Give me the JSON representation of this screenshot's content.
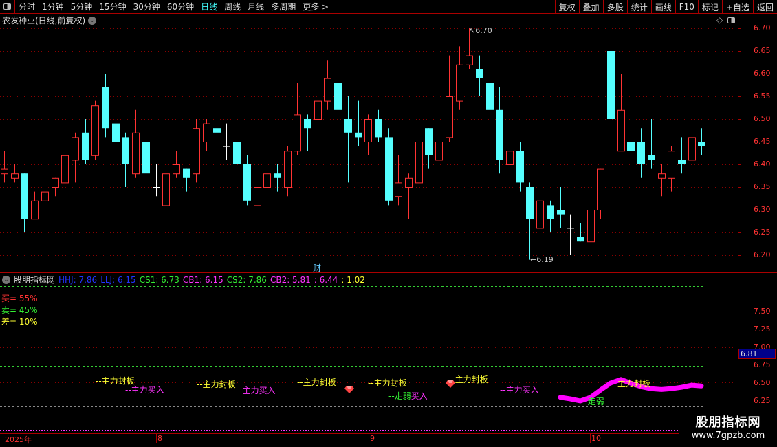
{
  "toolbar": {
    "periods": [
      "分时",
      "1分钟",
      "5分钟",
      "15分钟",
      "30分钟",
      "60分钟",
      "日线",
      "周线",
      "月线",
      "多周期",
      "更多 >"
    ],
    "active_period": "日线",
    "buttons": [
      "复权",
      "叠加",
      "多股",
      "统计",
      "画线",
      "F10",
      "标记",
      "+自选",
      "返回"
    ]
  },
  "title": "农发种业(日线,前复权)",
  "main_axis": [
    "6.70",
    "6.65",
    "6.60",
    "6.55",
    "6.50",
    "6.45",
    "6.40",
    "6.35",
    "6.30",
    "6.25",
    "6.20"
  ],
  "max_label": "6.70",
  "min_label": "6.19",
  "event_marker": "财",
  "indicator": {
    "name": "股朋指标网",
    "values": [
      {
        "label": "HHJ: 7.86",
        "color": "#2233ff"
      },
      {
        "label": "LLJ: 6.15",
        "color": "#2233ff"
      },
      {
        "label": "CS1: 6.73",
        "color": "#33ee33"
      },
      {
        "label": "CB1: 6.15",
        "color": "#ff33ff"
      },
      {
        "label": "CS2: 7.86",
        "color": "#33ee33"
      },
      {
        "label": "CB2: 5.81",
        "color": "#ff33ff"
      },
      {
        "label": ": 6.44",
        "color": "#ff33ff"
      },
      {
        "label": ": 1.02",
        "color": "#ffff33"
      }
    ],
    "buy": "买= 55%",
    "sell": "卖= 45%",
    "diff": "差= 10%",
    "axis": [
      "7.50",
      "7.25",
      "7.00",
      "6.75",
      "6.50",
      "6.25"
    ],
    "current": "6.81",
    "annotations": {
      "seal": "--主力封板",
      "buy": "--主力买入",
      "weak_buy_a": "--走弱",
      "weak_buy_b": "买入",
      "weak": "--走弱",
      "seal_plain": "主力封板"
    },
    "pink_line": [
      6.3,
      6.28,
      6.25,
      6.3,
      6.4,
      6.5,
      6.55,
      6.5,
      6.45,
      6.42,
      6.41,
      6.42,
      6.44,
      6.47,
      6.46
    ]
  },
  "time_axis": [
    "2025年",
    "8",
    "9",
    "10"
  ],
  "watermark": {
    "name": "股朋指标网",
    "url": "www.7gpzb.com"
  },
  "colors": {
    "up": "#ff3333",
    "down": "#55ffff",
    "doji": "#ffffff",
    "pink": "#ff00ff"
  },
  "chart_data": {
    "type": "candlestick",
    "fields": [
      "open",
      "high",
      "low",
      "close"
    ],
    "candles": [
      [
        6.38,
        6.43,
        6.36,
        6.39
      ],
      [
        6.37,
        6.4,
        6.36,
        6.38
      ],
      [
        6.38,
        6.38,
        6.25,
        6.28
      ],
      [
        6.28,
        6.34,
        6.28,
        6.32
      ],
      [
        6.32,
        6.35,
        6.3,
        6.34
      ],
      [
        6.35,
        6.37,
        6.33,
        6.37
      ],
      [
        6.36,
        6.43,
        6.36,
        6.42
      ],
      [
        6.41,
        6.47,
        6.36,
        6.46
      ],
      [
        6.47,
        6.5,
        6.4,
        6.41
      ],
      [
        6.42,
        6.54,
        6.41,
        6.53
      ],
      [
        6.57,
        6.6,
        6.46,
        6.48
      ],
      [
        6.49,
        6.5,
        6.43,
        6.45
      ],
      [
        6.46,
        6.47,
        6.35,
        6.4
      ],
      [
        6.38,
        6.52,
        6.37,
        6.47
      ],
      [
        6.45,
        6.47,
        6.34,
        6.38
      ],
      [
        6.35,
        6.4,
        6.33,
        6.35
      ],
      [
        6.31,
        6.4,
        6.31,
        6.38
      ],
      [
        6.38,
        6.43,
        6.37,
        6.4
      ],
      [
        6.39,
        6.39,
        6.34,
        6.37
      ],
      [
        6.38,
        6.5,
        6.36,
        6.48
      ],
      [
        6.45,
        6.5,
        6.43,
        6.49
      ],
      [
        6.48,
        6.49,
        6.41,
        6.47
      ],
      [
        6.44,
        6.49,
        6.41,
        6.44
      ],
      [
        6.45,
        6.46,
        6.38,
        6.4
      ],
      [
        6.4,
        6.42,
        6.31,
        6.32
      ],
      [
        6.31,
        6.35,
        6.31,
        6.35
      ],
      [
        6.35,
        6.39,
        6.33,
        6.38
      ],
      [
        6.38,
        6.4,
        6.34,
        6.37
      ],
      [
        6.35,
        6.44,
        6.33,
        6.43
      ],
      [
        6.43,
        6.58,
        6.42,
        6.51
      ],
      [
        6.5,
        6.51,
        6.43,
        6.48
      ],
      [
        6.5,
        6.55,
        6.46,
        6.54
      ],
      [
        6.54,
        6.63,
        6.52,
        6.59
      ],
      [
        6.58,
        6.64,
        6.48,
        6.52
      ],
      [
        6.5,
        6.55,
        6.36,
        6.47
      ],
      [
        6.47,
        6.54,
        6.44,
        6.46
      ],
      [
        6.45,
        6.51,
        6.42,
        6.5
      ],
      [
        6.5,
        6.52,
        6.45,
        6.46
      ],
      [
        6.46,
        6.48,
        6.31,
        6.32
      ],
      [
        6.33,
        6.42,
        6.31,
        6.36
      ],
      [
        6.35,
        6.38,
        6.28,
        6.37
      ],
      [
        6.36,
        6.48,
        6.35,
        6.45
      ],
      [
        6.48,
        6.48,
        6.39,
        6.42
      ],
      [
        6.41,
        6.45,
        6.38,
        6.45
      ],
      [
        6.46,
        6.64,
        6.45,
        6.55
      ],
      [
        6.54,
        6.66,
        6.52,
        6.62
      ],
      [
        6.62,
        6.7,
        6.61,
        6.64
      ],
      [
        6.61,
        6.64,
        6.55,
        6.59
      ],
      [
        6.58,
        6.59,
        6.49,
        6.52
      ],
      [
        6.52,
        6.57,
        6.38,
        6.41
      ],
      [
        6.4,
        6.46,
        6.39,
        6.43
      ],
      [
        6.43,
        6.45,
        6.34,
        6.36
      ],
      [
        6.35,
        6.36,
        6.19,
        6.28
      ],
      [
        6.26,
        6.33,
        6.24,
        6.32
      ],
      [
        6.31,
        6.32,
        6.25,
        6.28
      ],
      [
        6.3,
        6.35,
        6.26,
        6.29
      ],
      [
        6.26,
        6.29,
        6.2,
        6.26
      ],
      [
        6.24,
        6.27,
        6.23,
        6.23
      ],
      [
        6.23,
        6.31,
        6.23,
        6.3
      ],
      [
        6.3,
        6.39,
        6.28,
        6.39
      ],
      [
        6.65,
        6.68,
        6.46,
        6.5
      ],
      [
        6.43,
        6.6,
        6.43,
        6.52
      ],
      [
        6.45,
        6.49,
        6.41,
        6.43
      ],
      [
        6.45,
        6.48,
        6.37,
        6.4
      ],
      [
        6.42,
        6.5,
        6.39,
        6.41
      ],
      [
        6.37,
        6.4,
        6.33,
        6.38
      ],
      [
        6.37,
        6.44,
        6.34,
        6.43
      ],
      [
        6.41,
        6.46,
        6.38,
        6.4
      ],
      [
        6.41,
        6.46,
        6.39,
        6.46
      ],
      [
        6.45,
        6.48,
        6.42,
        6.44
      ]
    ],
    "ylim": [
      6.2,
      6.7
    ]
  }
}
